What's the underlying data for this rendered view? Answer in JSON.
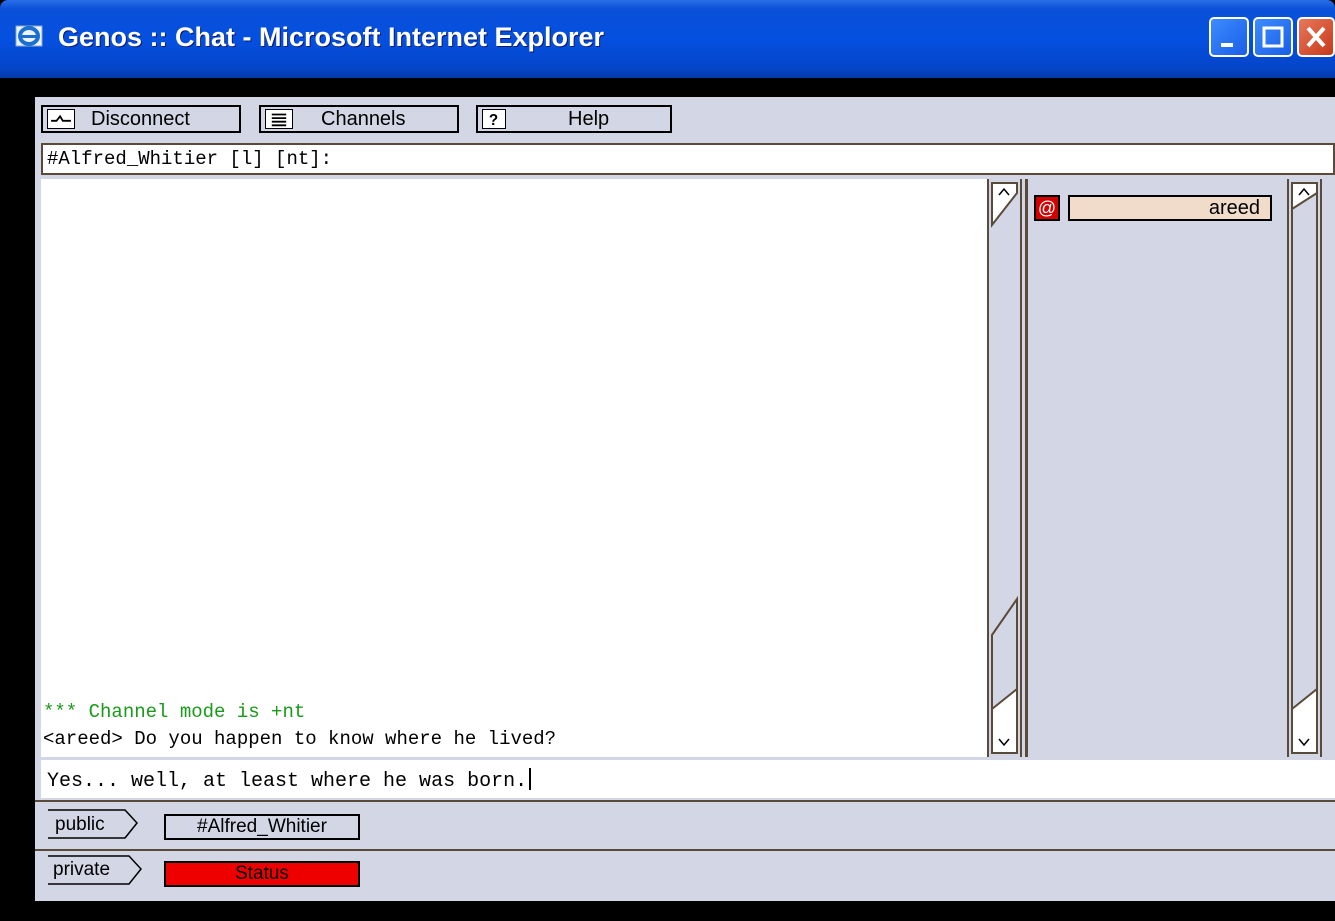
{
  "window": {
    "title": "Genos :: Chat - Microsoft Internet Explorer",
    "app_icon": "ie-icon",
    "controls": [
      "minimize-icon",
      "maximize-icon",
      "close-icon"
    ]
  },
  "toolbar": {
    "disconnect_label": "Disconnect",
    "channels_label": "Channels",
    "help_label": "Help"
  },
  "topic": "#Alfred_Whitier [l] [nt]:",
  "chat": {
    "lines": [
      {
        "text": "*** Channel mode is +nt",
        "color": "#1a9a1a"
      },
      {
        "text": "<areed> Do you happen to know where he lived?",
        "color": "#000000"
      }
    ]
  },
  "nicklist": {
    "users": [
      {
        "nick": "areed",
        "op_symbol": "@",
        "op_color": "#d40000"
      }
    ]
  },
  "input": {
    "value": "Yes...  well, at least where he was born."
  },
  "tabs": {
    "public": {
      "label": "public",
      "item": "#Alfred_Whitier"
    },
    "private": {
      "label": "private",
      "item": "Status",
      "item_color": "#ee0000"
    }
  }
}
